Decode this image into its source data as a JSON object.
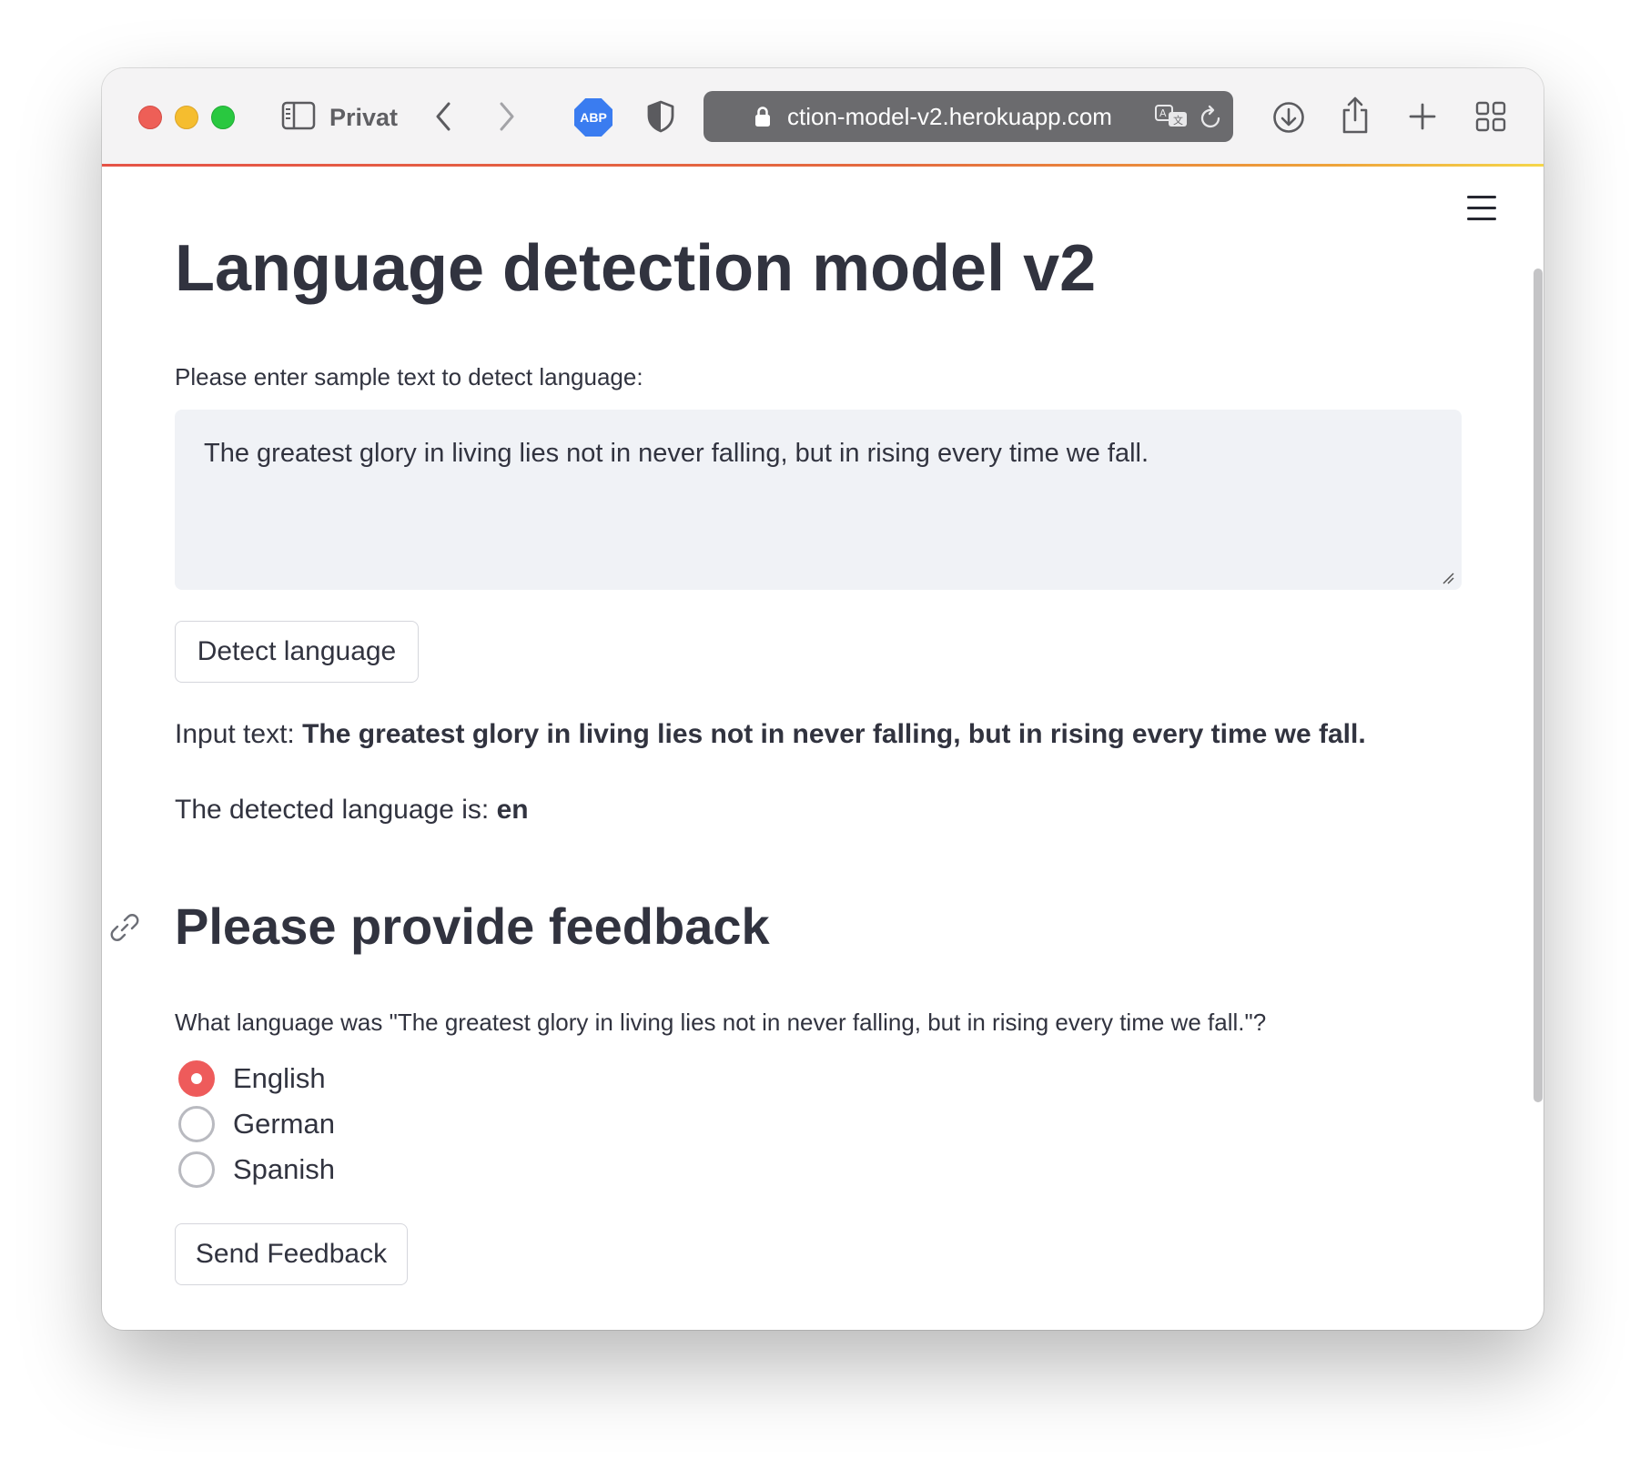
{
  "browser": {
    "profile_label": "Privat",
    "adblock_label": "ABP",
    "url": "ction-model-v2.herokuapp.com"
  },
  "app": {
    "title": "Language detection model v2",
    "prompt_label": "Please enter sample text to detect language:",
    "textarea_value": "The greatest glory in living lies not in never falling, but in rising every time we fall.",
    "detect_button": "Detect language",
    "input_text_prefix": "Input text:",
    "input_text_value": "The greatest glory in living lies not in never falling, but in rising every time we fall.",
    "detected_prefix": "The detected language is:",
    "detected_value": "en",
    "feedback_heading": "Please provide feedback",
    "feedback_question": "What language was \"The greatest glory in living lies not in never falling, but in rising every time we fall.\"?",
    "options": [
      {
        "label": "English",
        "selected": true
      },
      {
        "label": "German",
        "selected": false
      },
      {
        "label": "Spanish",
        "selected": false
      }
    ],
    "send_button": "Send Feedback"
  },
  "colors": {
    "accent": "#ee5b5b",
    "text": "#31333f",
    "input_bg": "#f0f2f6"
  }
}
